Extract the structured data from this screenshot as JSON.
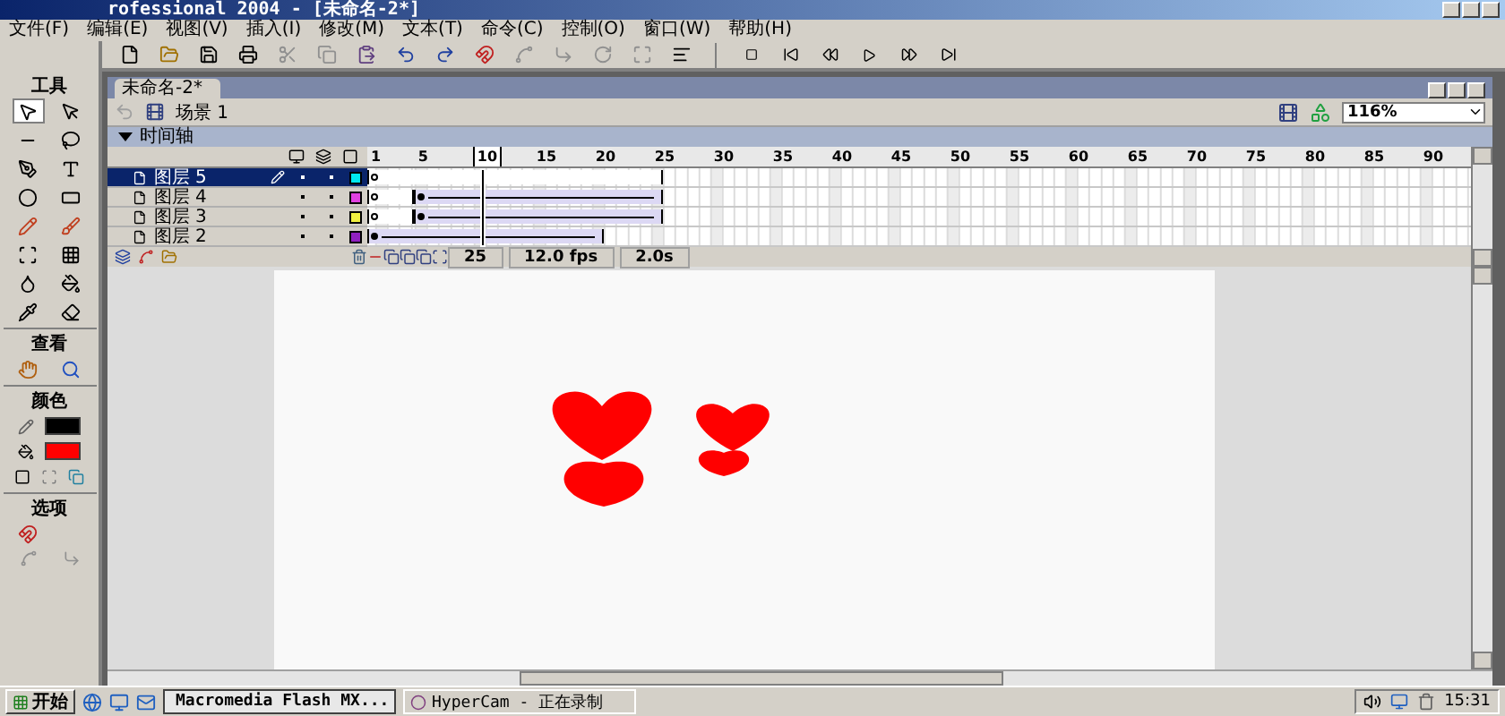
{
  "window": {
    "title": "rofessional 2004 - [未命名-2*]"
  },
  "menu": [
    "文件(F)",
    "编辑(E)",
    "视图(V)",
    "插入(I)",
    "修改(M)",
    "文本(T)",
    "命令(C)",
    "控制(O)",
    "窗口(W)",
    "帮助(H)"
  ],
  "tools": {
    "title": "工具",
    "view_title": "查看",
    "colors_title": "颜色",
    "options_title": "选项",
    "swatches": [
      {
        "kind": "stroke",
        "color": "#000000"
      },
      {
        "kind": "fill",
        "color": "#ff0000"
      }
    ]
  },
  "document": {
    "tab": "未命名-2*",
    "scene": "场景 1",
    "zoom": "116%"
  },
  "timeline": {
    "title": "时间轴",
    "expanded": true,
    "ruler": [
      {
        "label": "1",
        "selected": false
      },
      {
        "label": "5",
        "selected": false
      },
      {
        "label": "10",
        "selected": true
      },
      {
        "label": "15",
        "selected": false
      },
      {
        "label": "20",
        "selected": false
      },
      {
        "label": "25",
        "selected": false
      },
      {
        "label": "30",
        "selected": false
      },
      {
        "label": "35",
        "selected": false
      },
      {
        "label": "40",
        "selected": false
      },
      {
        "label": "45",
        "selected": false
      },
      {
        "label": "50",
        "selected": false
      },
      {
        "label": "55",
        "selected": false
      },
      {
        "label": "60",
        "selected": false
      },
      {
        "label": "65",
        "selected": false
      },
      {
        "label": "70",
        "selected": false
      },
      {
        "label": "75",
        "selected": false
      },
      {
        "label": "80",
        "selected": false
      },
      {
        "label": "85",
        "selected": false
      },
      {
        "label": "90",
        "selected": false
      }
    ],
    "layers": [
      {
        "name": "图层 5",
        "selected": true,
        "editing": true,
        "color": "#00e8f0",
        "kind": "static"
      },
      {
        "name": "图层 4",
        "selected": false,
        "editing": false,
        "color": "#e040e0",
        "kind": "delayed-tween"
      },
      {
        "name": "图层 3",
        "selected": false,
        "editing": false,
        "color": "#f0f040",
        "kind": "delayed-tween"
      },
      {
        "name": "图层 2",
        "selected": false,
        "editing": false,
        "color": "#9020c0",
        "kind": "short-tween"
      }
    ],
    "current_frame": "25",
    "frame_rate": "12.0 fps",
    "elapsed": "2.0s"
  },
  "taskbar": {
    "start": "开始",
    "tasks": [
      {
        "label": "Macromedia Flash MX...",
        "selected": true
      },
      {
        "label": "HyperCam - 正在录制",
        "selected": false
      }
    ],
    "clock": "15:31"
  }
}
